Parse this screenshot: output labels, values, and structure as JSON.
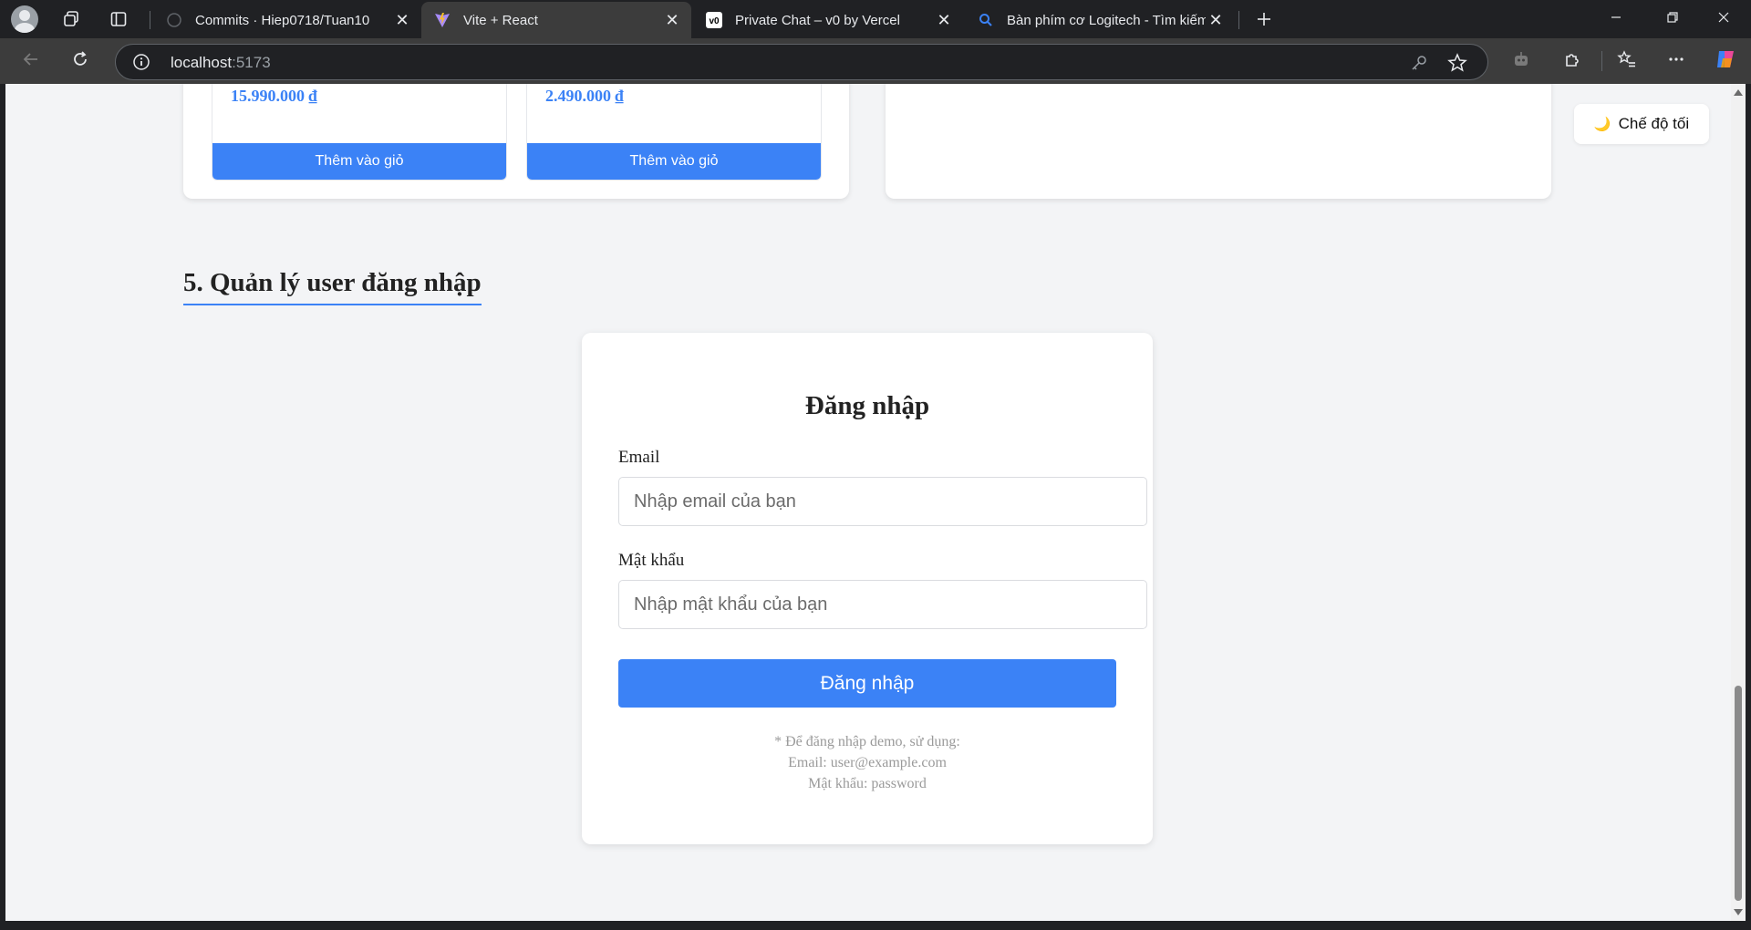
{
  "browser": {
    "tabs": [
      {
        "title": "Commits · Hiep0718/Tuan10",
        "favicon": "github-icon",
        "active": false
      },
      {
        "title": "Vite + React",
        "favicon": "vite-icon",
        "active": true
      },
      {
        "title": "Private Chat – v0 by Vercel",
        "favicon": "v0-icon",
        "active": false
      },
      {
        "title": "Bàn phím cơ Logitech - Tìm kiếm",
        "favicon": "search-icon",
        "active": false
      }
    ],
    "address": {
      "host": "localhost",
      "port": ":5173"
    }
  },
  "page": {
    "products": [
      {
        "price": "15.990.000 ₫",
        "add_label": "Thêm vào giỏ"
      },
      {
        "price": "2.490.000 ₫",
        "add_label": "Thêm vào giỏ"
      }
    ],
    "dark_mode_label": "Chế độ tối",
    "section_title": "5. Quản lý user đăng nhập",
    "login": {
      "title": "Đăng nhập",
      "email_label": "Email",
      "email_placeholder": "Nhập email của bạn",
      "password_label": "Mật khẩu",
      "password_placeholder": "Nhập mật khẩu của bạn",
      "submit_label": "Đăng nhập",
      "hint_line1": "* Để đăng nhập demo, sử dụng:",
      "hint_line2": "Email: user@example.com",
      "hint_line3": "Mật khẩu: password"
    }
  },
  "colors": {
    "accent": "#3b82f6",
    "page_background": "#f3f4f6",
    "chrome_dark": "#202124",
    "chrome_toolbar": "#3c3c3c"
  }
}
